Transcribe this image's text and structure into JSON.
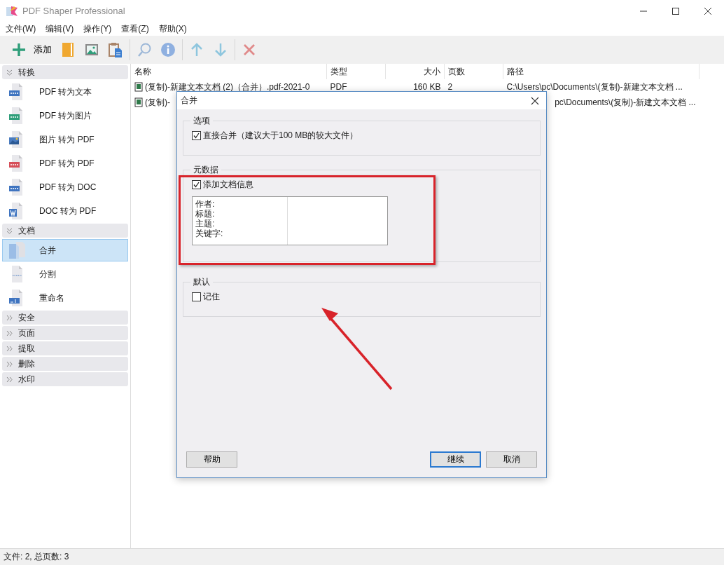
{
  "window": {
    "title": "PDF Shaper Professional"
  },
  "menu": [
    "文件(W)",
    "编辑(V)",
    "操作(Y)",
    "查看(Z)",
    "帮助(X)"
  ],
  "toolbar": [
    {
      "kind": "add",
      "label": "添加"
    },
    {
      "kind": "folder"
    },
    {
      "kind": "image"
    },
    {
      "kind": "clipboard"
    },
    {
      "kind": "separator"
    },
    {
      "kind": "search"
    },
    {
      "kind": "info"
    },
    {
      "kind": "separator"
    },
    {
      "kind": "up"
    },
    {
      "kind": "down"
    },
    {
      "kind": "separator"
    },
    {
      "kind": "delete"
    }
  ],
  "sidebar": {
    "groups": [
      {
        "label": "转换",
        "expanded": true,
        "items": [
          {
            "label": "PDF 转为文本",
            "kind": "txt",
            "selected": false
          },
          {
            "label": "PDF 转为图片",
            "kind": "jpg",
            "selected": false
          },
          {
            "label": "图片 转为 PDF",
            "kind": "image",
            "selected": false
          },
          {
            "label": "PDF 转为 PDF",
            "kind": "pdf",
            "selected": false
          },
          {
            "label": "PDF 转为 DOC",
            "kind": "doc",
            "selected": false
          },
          {
            "label": "DOC 转为 PDF",
            "kind": "word",
            "selected": false
          }
        ]
      },
      {
        "label": "文档",
        "expanded": true,
        "items": [
          {
            "label": "合并",
            "kind": "merge",
            "selected": true
          },
          {
            "label": "分割",
            "kind": "split",
            "selected": false
          },
          {
            "label": "重命名",
            "kind": "rename",
            "selected": false
          }
        ]
      },
      {
        "label": "安全",
        "expanded": false
      },
      {
        "label": "页面",
        "expanded": false
      },
      {
        "label": "提取",
        "expanded": false
      },
      {
        "label": "删除",
        "expanded": false
      },
      {
        "label": "水印",
        "expanded": false
      }
    ]
  },
  "table": {
    "columns": [
      "名称",
      "类型",
      "大小",
      "页数",
      "路径"
    ],
    "rows": [
      [
        "(复制)-新建文本文档 (2)（合并）.pdf-2021-0",
        "PDF",
        "160 KB",
        "2",
        "C:\\Users\\pc\\Documents\\(复制)-新建文本文档 ..."
      ],
      [
        "(复制)-",
        "",
        "",
        "",
        "pc\\Documents\\(复制)-新建文本文档 ..."
      ]
    ]
  },
  "dialog": {
    "title": "合并",
    "sections": [
      {
        "title": "选项",
        "checkbox": {
          "label": "直接合并（建议大于100 MB的较大文件）",
          "checked": true
        }
      },
      {
        "title": "元数据",
        "checkbox": {
          "label": "添加文档信息",
          "checked": true
        },
        "fields": [
          "作者:",
          "标题:",
          "主题:",
          "关键字:"
        ]
      },
      {
        "title": "默认",
        "checkbox": {
          "label": "记住",
          "checked": false
        }
      }
    ],
    "buttons": [
      {
        "label": "帮助",
        "default": false
      },
      {
        "label": "继续",
        "default": true
      },
      {
        "label": "取消",
        "default": false
      }
    ]
  },
  "status_bar": "文件: 2, 总页数: 3"
}
